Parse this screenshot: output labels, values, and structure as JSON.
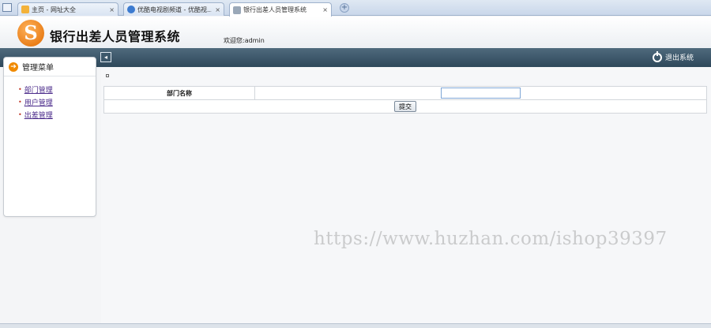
{
  "browser": {
    "tabs": [
      {
        "label": "主页 - 网址大全",
        "icon": "home-icon",
        "active": false
      },
      {
        "label": "优酷电视剧频道 - 优酷视...",
        "icon": "play-icon",
        "active": false
      },
      {
        "label": "银行出差人员管理系统",
        "icon": "page-icon",
        "active": true
      }
    ],
    "close_glyph": "×",
    "new_tab_glyph": "+"
  },
  "header": {
    "logo_letter": "S",
    "title": "银行出差人员管理系统",
    "welcome": "欢迎您:admin"
  },
  "navbar": {
    "collapse_glyph": "◂",
    "logout_label": "退出系统"
  },
  "sidebar": {
    "title": "管理菜单",
    "arrow_glyph": "➔",
    "items": [
      {
        "label": "部门管理"
      },
      {
        "label": "用户管理"
      },
      {
        "label": "出差管理"
      }
    ]
  },
  "form": {
    "field_label": "部门名称",
    "field_value": "",
    "submit_label": "提交"
  },
  "watermark": "https://www.huzhan.com/ishop39397",
  "colors": {
    "accent_orange": "#f08a00",
    "nav_dark": "#2e485b",
    "link_purple": "#4a2a8a"
  }
}
